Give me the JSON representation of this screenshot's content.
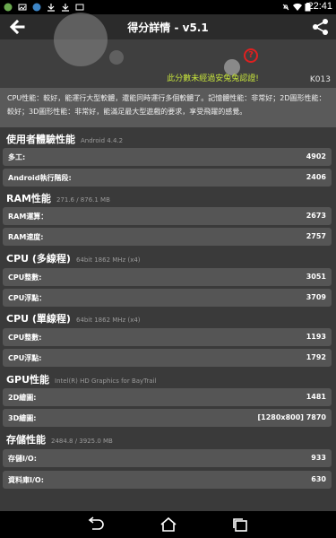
{
  "status_bar": {
    "time": "22:41"
  },
  "app_bar": {
    "title": "得分詳情 - v5.1"
  },
  "hero": {
    "warning": "此分數未經過安兔兔認證!",
    "help_symbol": "?",
    "device": "K013"
  },
  "description": "CPU性能：較好，能運行大型軟體，還能同時運行多個軟體了。記憶體性能：非常好；2D圖形性能：較好；3D圖形性能：非常好，能滿足最大型遊戲的要求，享受飛躍的感覺。",
  "sections": [
    {
      "title": "使用者體驗性能",
      "sub": "Android 4.4.2",
      "rows": [
        {
          "label": "多工:",
          "value": "4902"
        },
        {
          "label": "Android執行階段:",
          "value": "2406"
        }
      ]
    },
    {
      "title": "RAM性能",
      "sub": "271.6 / 876.1 MB",
      "rows": [
        {
          "label": "RAM運算：",
          "value": "2673"
        },
        {
          "label": "RAM速度:",
          "value": "2757"
        }
      ]
    },
    {
      "title": "CPU (多線程)",
      "sub": "64bit 1862 MHz (x4)",
      "rows": [
        {
          "label": "CPU整數:",
          "value": "3051"
        },
        {
          "label": "CPU浮點：",
          "value": "3709"
        }
      ]
    },
    {
      "title": "CPU (單線程)",
      "sub": "64bit 1862 MHz (x4)",
      "rows": [
        {
          "label": "CPU整數:",
          "value": "1193"
        },
        {
          "label": "CPU浮點:",
          "value": "1792"
        }
      ]
    },
    {
      "title": "GPU性能",
      "sub": "Intel(R) HD Graphics for BayTrail",
      "rows": [
        {
          "label": "2D繪圖:",
          "value": "1481"
        },
        {
          "label": "3D繪圖:",
          "value": "[1280x800] 7870"
        }
      ]
    },
    {
      "title": "存儲性能",
      "sub": "2484.8 / 3925.0 MB",
      "rows": [
        {
          "label": "存儲I/O:",
          "value": "933"
        },
        {
          "label": "資料庫I/O:",
          "value": "630"
        }
      ]
    }
  ]
}
